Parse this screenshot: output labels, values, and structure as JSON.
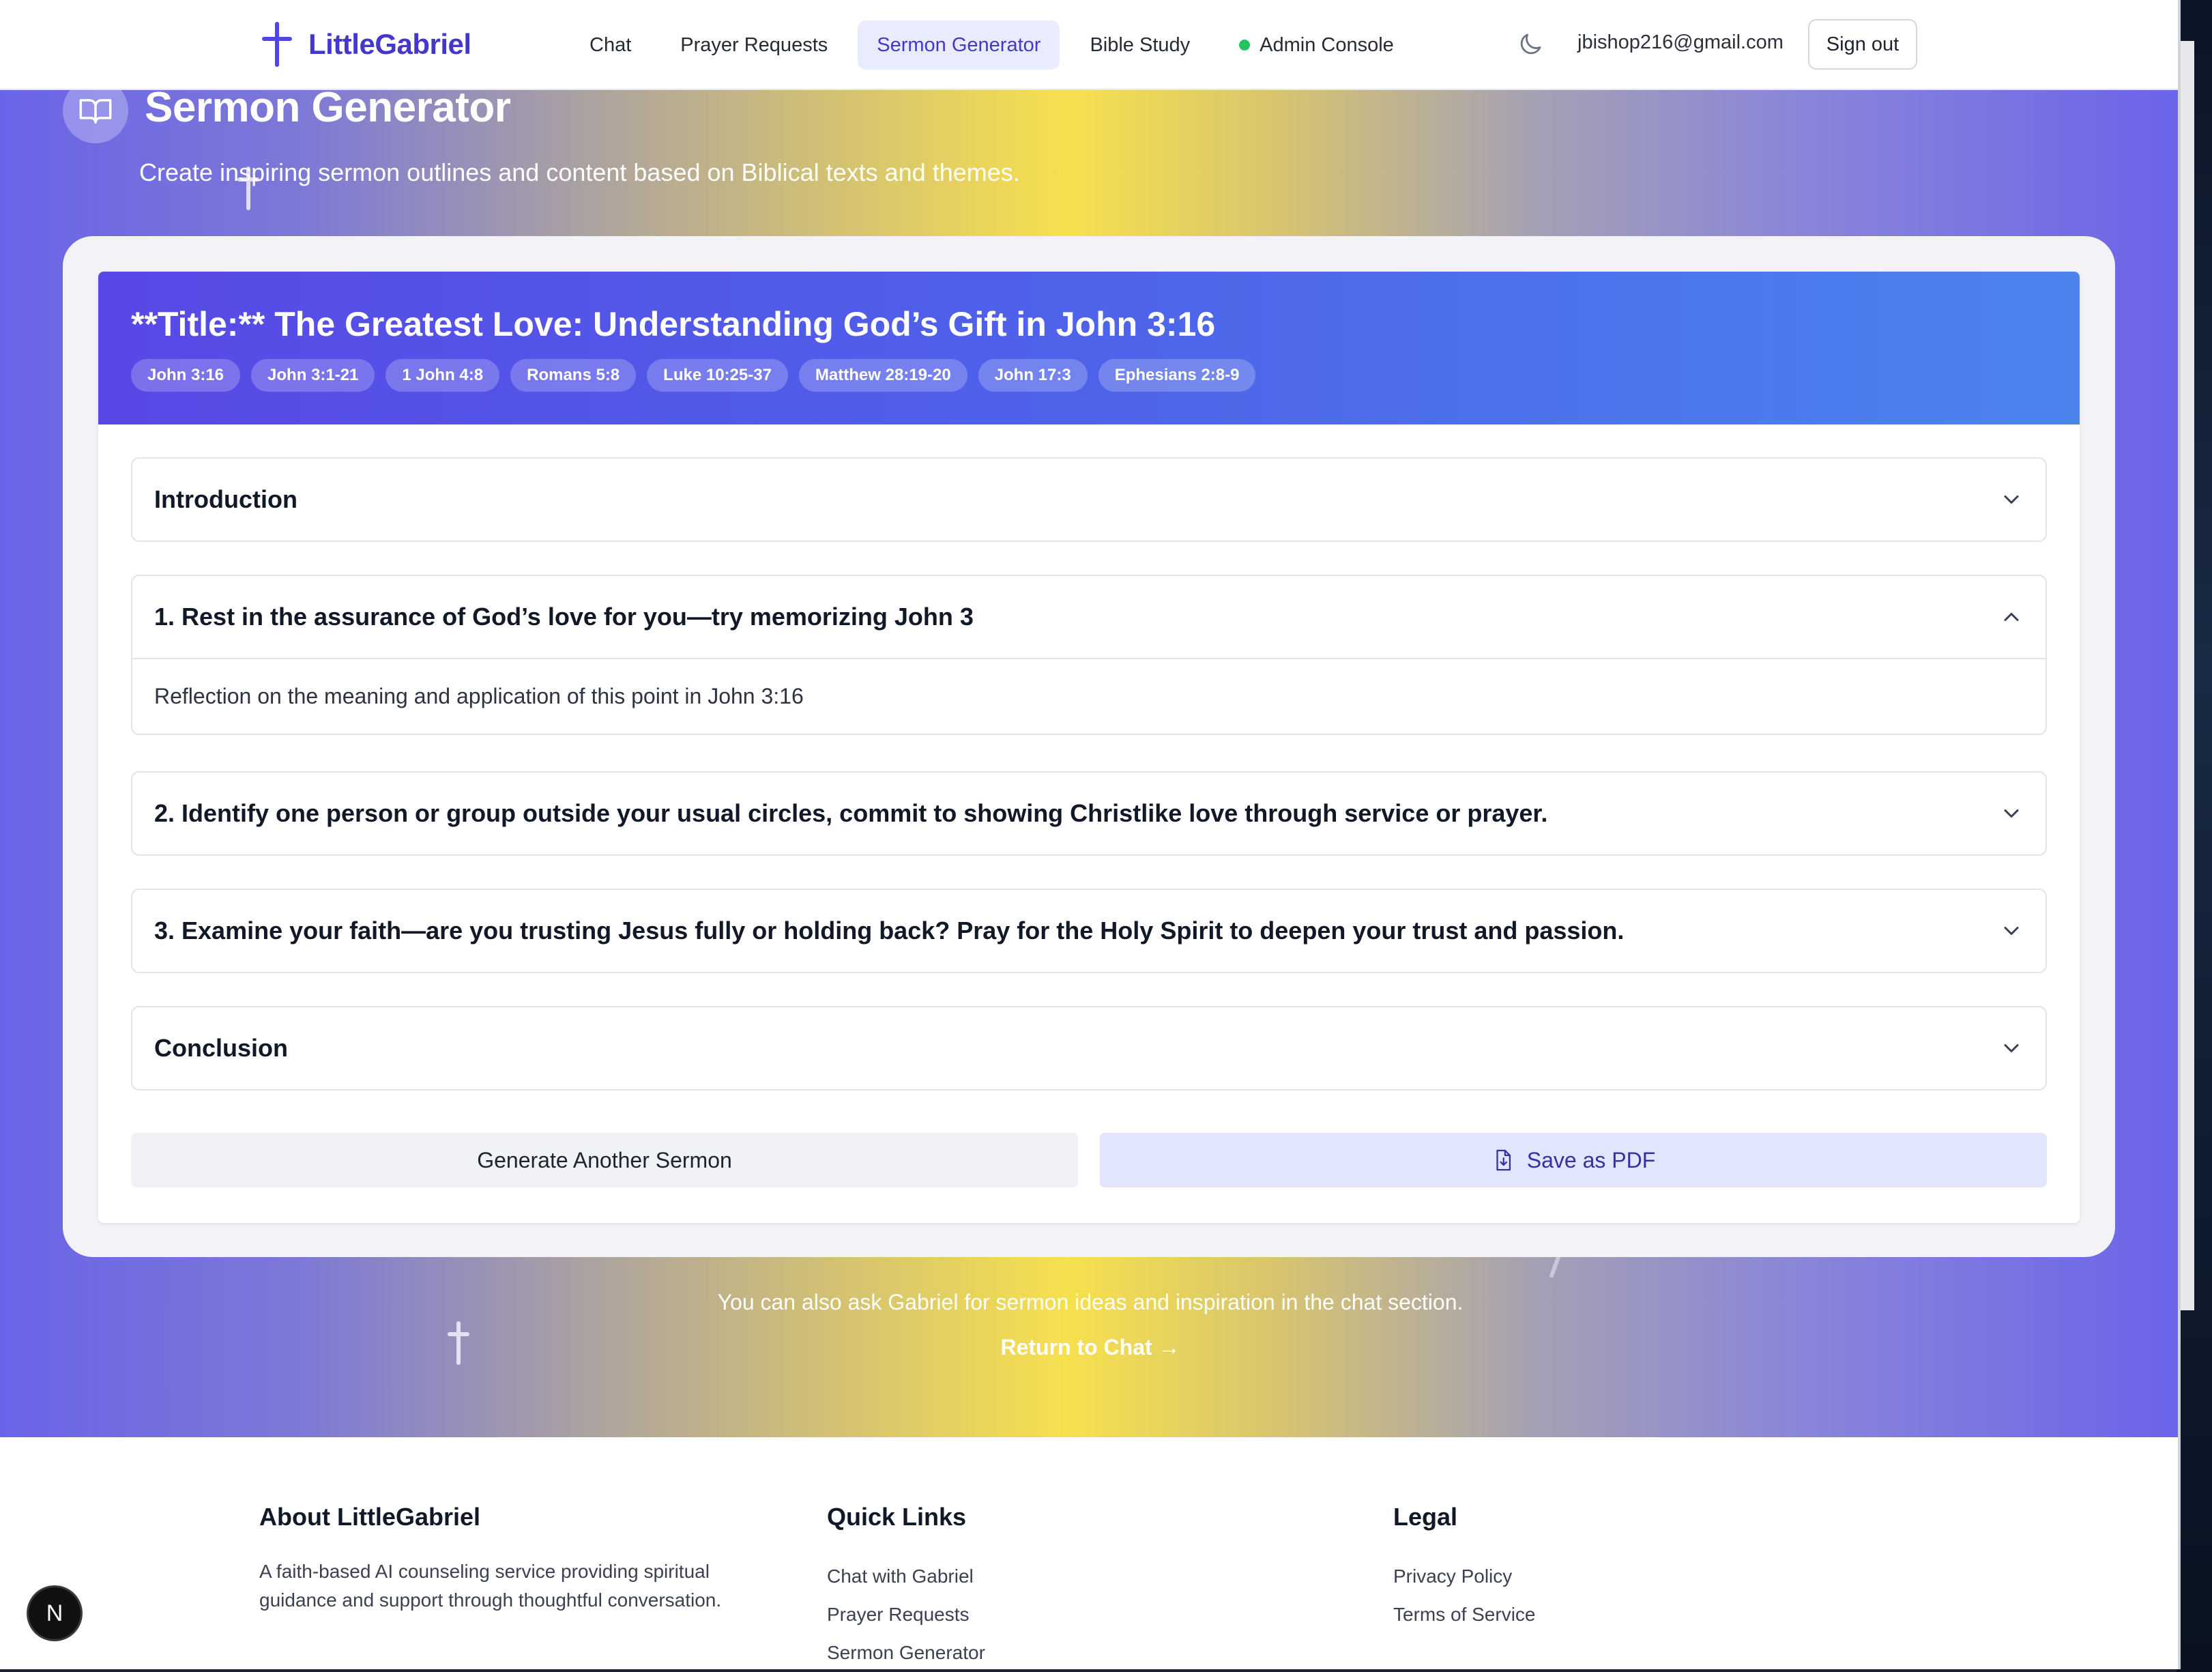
{
  "header": {
    "logo_text": "LittleGabriel",
    "nav": [
      {
        "label": "Chat"
      },
      {
        "label": "Prayer Requests"
      },
      {
        "label": "Sermon Generator",
        "active": true
      },
      {
        "label": "Bible Study"
      },
      {
        "label": "Admin Console",
        "status": "online"
      }
    ],
    "theme_toggle_icon": "moon-icon",
    "user_email": "jbishop216@gmail.com",
    "signout_label": "Sign out"
  },
  "page": {
    "title": "Sermon Generator",
    "subtitle": "Create inspiring sermon outlines and content based on Biblical texts and themes."
  },
  "sermon": {
    "title": "**Title:** The Greatest Love: Understanding God’s Gift in John 3:16",
    "references": [
      "John 3:16",
      "John 3:1-21",
      "1 John 4:8",
      "Romans 5:8",
      "Luke 10:25-37",
      "Matthew 28:19-20",
      "John 17:3",
      "Ephesians 2:8-9"
    ],
    "sections": [
      {
        "title": "Introduction",
        "expanded": false
      },
      {
        "title": "1. Rest in the assurance of God’s love for you—try memorizing John 3",
        "expanded": true,
        "body": "Reflection on the meaning and application of this point in John 3:16"
      },
      {
        "title": "2. Identify one person or group outside your usual circles, commit to showing Christlike love through service or prayer.",
        "expanded": false
      },
      {
        "title": "3. Examine your faith—are you trusting Jesus fully or holding back? Pray for the Holy Spirit to deepen your trust and passion.",
        "expanded": false
      },
      {
        "title": "Conclusion",
        "expanded": false
      }
    ],
    "generate_label": "Generate Another Sermon",
    "pdf_label": "Save as PDF"
  },
  "hint": {
    "text": "You can also ask Gabriel for sermon ideas and inspiration in the chat section.",
    "link": "Return to Chat →"
  },
  "footer": {
    "about": {
      "heading": "About LittleGabriel",
      "text": "A faith-based AI counseling service providing spiritual guidance and support through thoughtful conversation."
    },
    "quick_links": {
      "heading": "Quick Links",
      "items": [
        "Chat with Gabriel",
        "Prayer Requests",
        "Sermon Generator"
      ]
    },
    "legal": {
      "heading": "Legal",
      "items": [
        "Privacy Policy",
        "Terms of Service"
      ]
    }
  },
  "dev_badge": "N",
  "colors": {
    "accent": "#4338ca",
    "nav_active_bg": "#e9ebff",
    "status_online": "#22c55e",
    "sermon_header_start": "#5848e6",
    "sermon_header_end": "#4c84ee",
    "hero_center": "#f7e04e",
    "hero_edge": "#6a64e8"
  }
}
